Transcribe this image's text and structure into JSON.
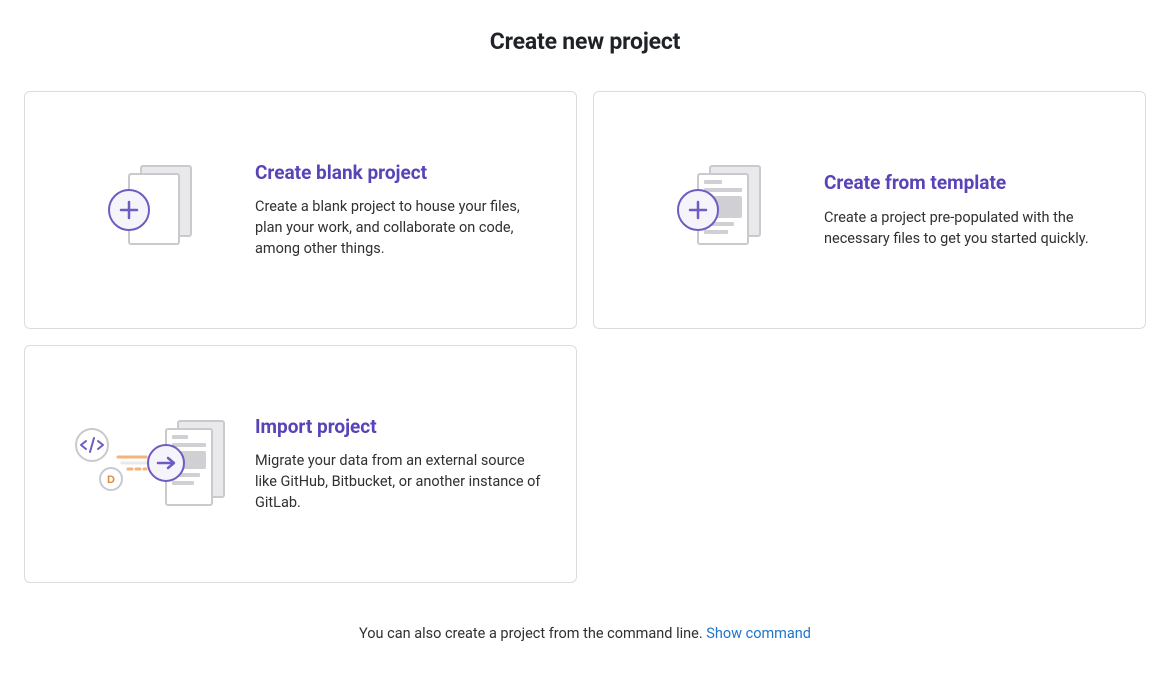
{
  "page": {
    "title": "Create new project"
  },
  "cards": {
    "blank": {
      "title": "Create blank project",
      "desc": "Create a blank project to house your files, plan your work, and collaborate on code, among other things."
    },
    "template": {
      "title": "Create from template",
      "desc": "Create a project pre-populated with the necessary files to get you started quickly."
    },
    "import": {
      "title": "Import project",
      "desc": "Migrate your data from an external source like GitHub, Bitbucket, or another instance of GitLab."
    }
  },
  "footer": {
    "text": "You can also create a project from the command line. ",
    "link": "Show command"
  },
  "colors": {
    "accent": "#5943b6",
    "link": "#1f75cb",
    "border": "#dcdcde"
  }
}
